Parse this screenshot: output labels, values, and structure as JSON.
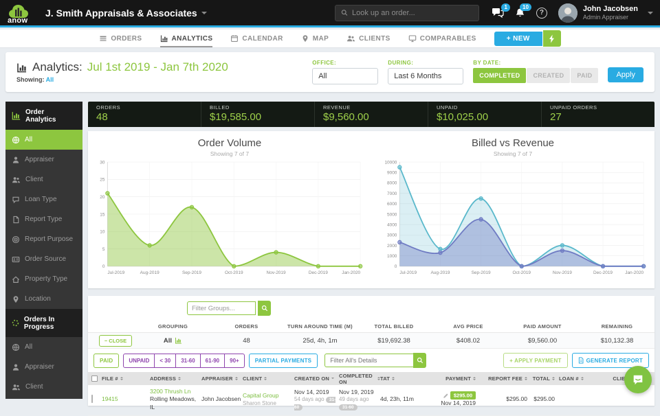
{
  "colors": {
    "green": "#8dc63f",
    "blue": "#29abe2",
    "billed_teal": "#59b8cb",
    "revenue_purple": "#6f7bc3"
  },
  "header": {
    "logo_text": "anow",
    "company": "J. Smith Appraisals & Associates",
    "search_placeholder": "Look up an order...",
    "messages_badge": "1",
    "notifications_badge": "10",
    "help_label": "?",
    "user_name": "John Jacobsen",
    "user_role": "Admin Appraiser"
  },
  "nav": {
    "items": [
      {
        "label": "ORDERS",
        "icon": "orders-icon"
      },
      {
        "label": "ANALYTICS",
        "icon": "analytics-icon",
        "active": true
      },
      {
        "label": "CALENDAR",
        "icon": "calendar-icon"
      },
      {
        "label": "MAP",
        "icon": "map-pin-icon"
      },
      {
        "label": "CLIENTS",
        "icon": "clients-icon"
      },
      {
        "label": "COMPARABLES",
        "icon": "comparables-icon"
      }
    ],
    "new_button": "+ NEW"
  },
  "page_header": {
    "title": "Analytics:",
    "date_range": "Jul 1st 2019 - Jan 7th 2020",
    "showing_label": "Showing:",
    "showing_value": "All",
    "office_label": "OFFICE:",
    "office_value": "All",
    "during_label": "DURING:",
    "during_value": "Last 6 Months",
    "by_date_label": "BY DATE:",
    "by_date_options": {
      "completed": "COMPLETED",
      "created": "CREATED",
      "paid": "PAID"
    },
    "apply_label": "Apply"
  },
  "sidebar": {
    "sections": [
      {
        "title": "Order Analytics",
        "items": [
          {
            "label": "All",
            "icon": "globe-icon",
            "active": true
          },
          {
            "label": "Appraiser",
            "icon": "person-icon"
          },
          {
            "label": "Client",
            "icon": "people-icon"
          },
          {
            "label": "Loan Type",
            "icon": "speech-icon"
          },
          {
            "label": "Report Type",
            "icon": "file-icon"
          },
          {
            "label": "Report Purpose",
            "icon": "target-icon"
          },
          {
            "label": "Order Source",
            "icon": "id-card-icon"
          },
          {
            "label": "Property Type",
            "icon": "house-icon"
          },
          {
            "label": "Location",
            "icon": "map-pin-icon"
          }
        ]
      },
      {
        "title": "Orders In Progress",
        "items": [
          {
            "label": "All",
            "icon": "globe-icon"
          },
          {
            "label": "Appraiser",
            "icon": "person-icon"
          },
          {
            "label": "Client",
            "icon": "people-icon"
          }
        ]
      }
    ]
  },
  "stats": [
    {
      "label": "ORDERS",
      "value": "48"
    },
    {
      "label": "BILLED",
      "value": "$19,585.00"
    },
    {
      "label": "REVENUE",
      "value": "$9,560.00"
    },
    {
      "label": "UNPAID",
      "value": "$10,025.00"
    },
    {
      "label": "UNPAID ORDERS",
      "value": "27"
    }
  ],
  "chart_data": [
    {
      "type": "area",
      "title": "Order Volume",
      "subtitle": "Showing 7 of 7",
      "categories": [
        "Jul-2019",
        "Aug-2019",
        "Sep-2019",
        "Oct-2019",
        "Nov-2019",
        "Dec-2019",
        "Jan-2020"
      ],
      "series": [
        {
          "name": "Orders",
          "values": [
            21,
            6,
            17,
            0,
            4,
            0,
            0
          ],
          "line_color": "#8dc63f",
          "fill_color": "rgba(141,198,63,0.45)"
        }
      ],
      "ylim": [
        0,
        30
      ],
      "ytick_step": 5,
      "grid": true,
      "legend": "none"
    },
    {
      "type": "area",
      "title": "Billed vs Revenue",
      "subtitle": "Showing 7 of 7",
      "categories": [
        "Jul-2019",
        "Aug-2019",
        "Sep-2019",
        "Oct-2019",
        "Nov-2019",
        "Dec-2019",
        "Jan-2020"
      ],
      "series": [
        {
          "name": "Billed",
          "values": [
            9500,
            1650,
            6500,
            0,
            2000,
            0,
            0
          ],
          "line_color": "#59b8cb",
          "fill_color": "rgba(89,184,203,0.22)"
        },
        {
          "name": "Revenue",
          "values": [
            2300,
            1300,
            4500,
            0,
            1500,
            0,
            0
          ],
          "line_color": "#6f7bc3",
          "fill_color": "rgba(111,123,195,0.40)"
        }
      ],
      "ylim": [
        0,
        10000
      ],
      "ytick_step": 1000,
      "grid": true,
      "legend": "none"
    }
  ],
  "groups_panel": {
    "filter_placeholder": "Filter Groups...",
    "columns": [
      "GROUPING",
      "ORDERS",
      "TURN AROUND TIME (M)",
      "TOTAL BILLED",
      "AVG PRICE",
      "PAID AMOUNT",
      "REMAINING"
    ],
    "close_label": "− CLOSE",
    "row": {
      "grouping": "All",
      "orders": "48",
      "tat": "25d, 4h, 1m",
      "total_billed": "$19,692.38",
      "avg_price": "$408.02",
      "paid_amount": "$9,560.00",
      "remaining": "$10,132.38"
    },
    "filters": {
      "paid": "PAID",
      "unpaid": "UNPAID",
      "lt30": "< 30",
      "b3160": "31-60",
      "b6190": "61-90",
      "b90": "90+",
      "partial": "PARTIAL PAYMENTS",
      "details_placeholder": "Filter All's Details",
      "apply_payment": "+ APPLY PAYMENT",
      "generate_report": "GENERATE REPORT"
    }
  },
  "orders_table": {
    "columns": {
      "file": "FILE #",
      "address": "ADDRESS",
      "appraiser": "APPRAISER",
      "client": "CLIENT",
      "created": "CREATED ON",
      "completed": "COMPLETED ON",
      "tat": "TAT",
      "payment": "PAYMENT",
      "report_fee": "REPORT FEE",
      "total": "TOTAL",
      "loan": "LOAN #",
      "client_ref": "CLIENT REF."
    },
    "row": {
      "file_no": "19415",
      "address_line1": "3200 Thrush Ln",
      "address_line2": "Rolling Meadows, IL",
      "appraiser": "John Jacobsen",
      "client": "Capital Group",
      "client_contact": "Sharon Stone",
      "created_on": "Nov 14, 2019",
      "created_ago": "54 days ago",
      "created_badge": "31-60",
      "completed_on": "Nov 19, 2019",
      "completed_ago": "49 days ago",
      "completed_badge": "31-60",
      "tat": "4d, 23h, 11m",
      "payment_amount": "$295.00",
      "payment_date": "Nov 14, 2019",
      "report_fee": "$295.00",
      "total": "$295.00"
    }
  }
}
